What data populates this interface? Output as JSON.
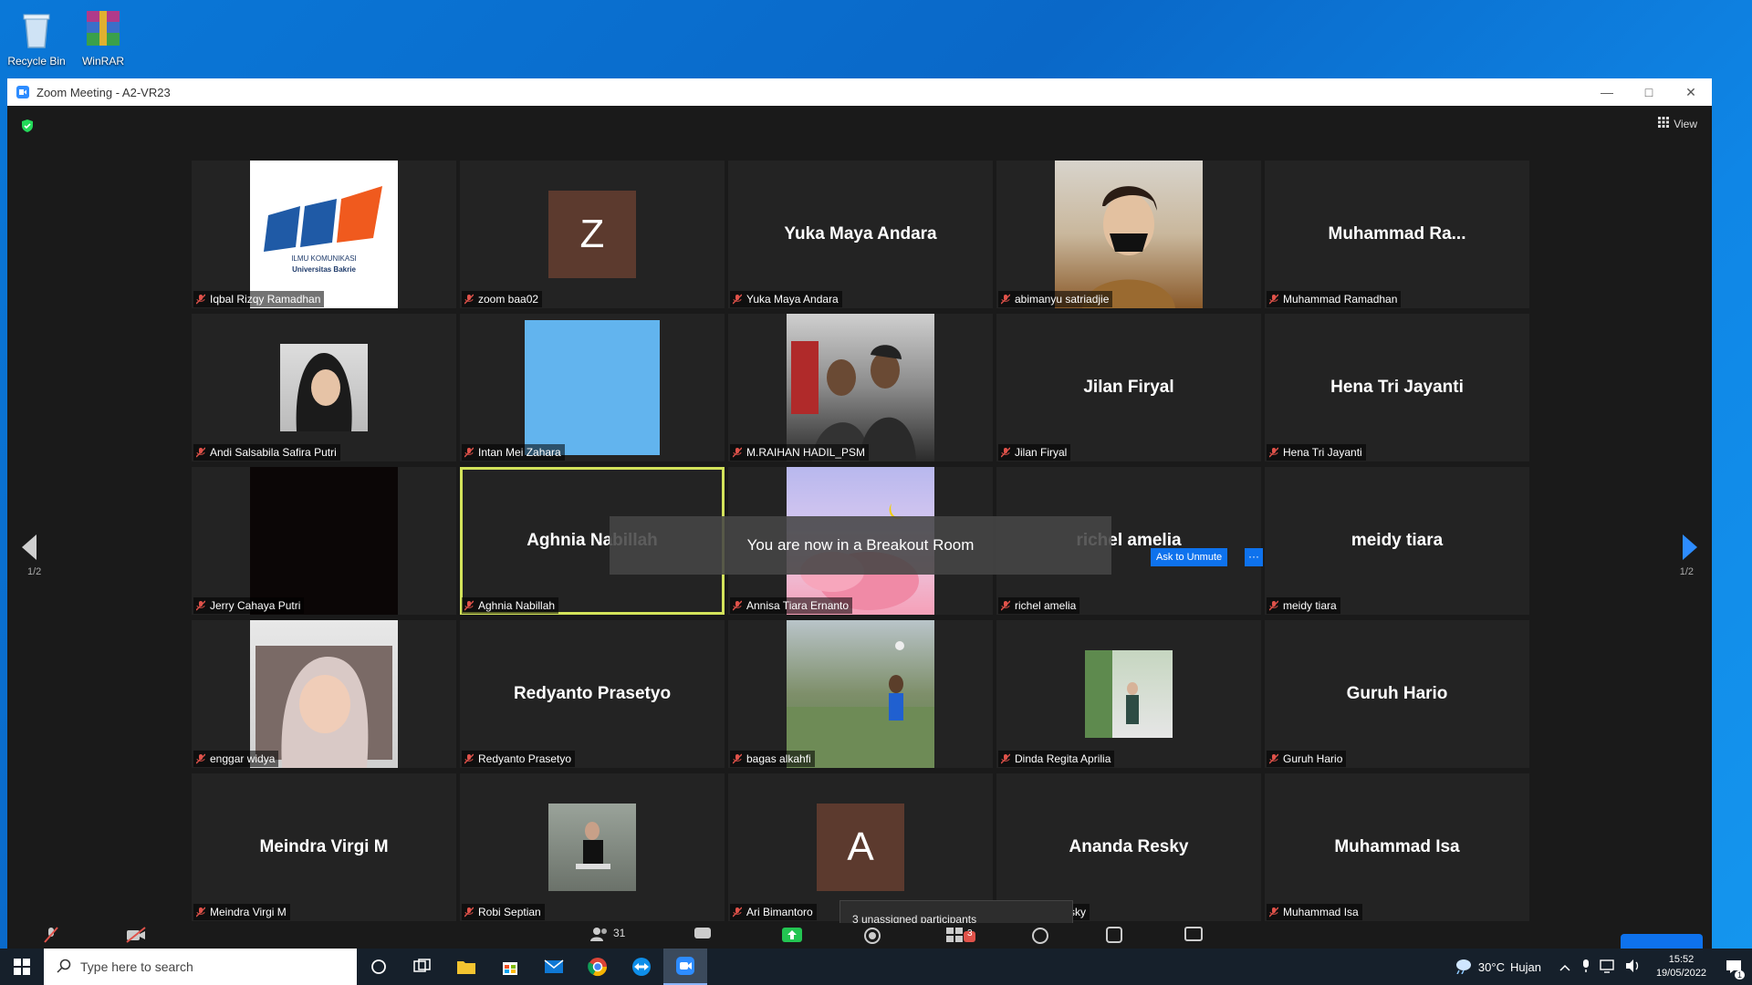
{
  "desktop": {
    "icons": [
      {
        "label": "Recycle Bin"
      },
      {
        "label": "WinRAR"
      }
    ]
  },
  "window": {
    "title": "Zoom Meeting - A2-VR23",
    "view_label": "View"
  },
  "participants": [
    {
      "display": "",
      "label": "Iqbal Rizqy Ramadhan",
      "type": "logo"
    },
    {
      "display": "Z",
      "label": "zoom baa02",
      "type": "letter"
    },
    {
      "display": "Yuka Maya Andara",
      "label": "Yuka Maya Andara",
      "type": "name"
    },
    {
      "display": "",
      "label": "abimanyu satriadjie",
      "type": "photo"
    },
    {
      "display": "Muhammad  Ra...",
      "label": "Muhammad Ramadhan",
      "type": "name"
    },
    {
      "display": "",
      "label": "Andi Salsabila Safira Putri",
      "type": "photo"
    },
    {
      "display": "",
      "label": "Intan Mei Zahara",
      "type": "photo"
    },
    {
      "display": "",
      "label": "M.RAIHAN HADIL_PSM",
      "type": "photo"
    },
    {
      "display": "Jilan Firyal",
      "label": "Jilan Firyal",
      "type": "name"
    },
    {
      "display": "Hena Tri Jayanti",
      "label": "Hena Tri Jayanti",
      "type": "name"
    },
    {
      "display": "",
      "label": "Jerry Cahaya Putri",
      "type": "photo"
    },
    {
      "display": "Aghnia Nabillah",
      "label": "Aghnia Nabillah",
      "type": "name"
    },
    {
      "display": "",
      "label": "Annisa Tiara Ernanto",
      "type": "photo"
    },
    {
      "display": "richel amelia",
      "label": "richel amelia",
      "type": "name"
    },
    {
      "display": "meidy tiara",
      "label": "meidy tiara",
      "type": "name"
    },
    {
      "display": "",
      "label": "enggar widya",
      "type": "photo"
    },
    {
      "display": "Redyanto Prasetyo",
      "label": "Redyanto Prasetyo",
      "type": "name"
    },
    {
      "display": "",
      "label": "bagas alkahfi",
      "type": "photo"
    },
    {
      "display": "",
      "label": "Dinda Regita Aprilia",
      "type": "photo"
    },
    {
      "display": "Guruh Hario",
      "label": "Guruh Hario",
      "type": "name"
    },
    {
      "display": "Meindra Virgi M",
      "label": "Meindra Virgi M",
      "type": "name"
    },
    {
      "display": "",
      "label": "Robi Septian",
      "type": "photo"
    },
    {
      "display": "A",
      "label": "Ari Bimantoro",
      "type": "letter"
    },
    {
      "display": "Ananda Resky",
      "label": "Ananda Resky",
      "type": "name"
    },
    {
      "display": "Muhammad Isa",
      "label": "Muhammad Isa",
      "type": "name"
    }
  ],
  "logo_text": {
    "line1": "ILMU KOMUNIKASI",
    "line2": "Universitas Bakrie"
  },
  "pagination": {
    "left": "1/2",
    "right": "1/2"
  },
  "toast": "You are now in a Breakout Room",
  "ask_to_unmute": "Ask to Unmute",
  "more_label": "···",
  "popup": "3 unassigned participants",
  "toolbar": {
    "participants_count": "31",
    "breakout_badge": "3"
  },
  "taskbar": {
    "search_placeholder": "Type here to search",
    "weather_temp": "30°C",
    "weather_text": "Hujan",
    "time": "15:52",
    "date": "19/05/2022",
    "notification_count": "1"
  }
}
